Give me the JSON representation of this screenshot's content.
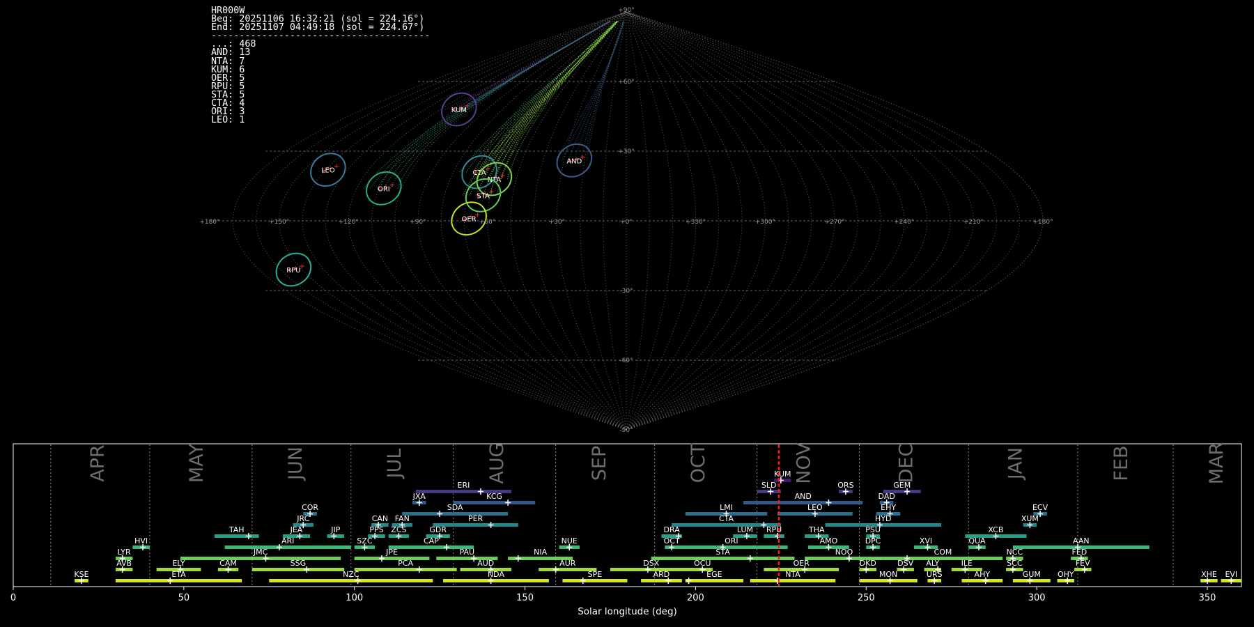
{
  "header": {
    "station": "HR000W",
    "beg": "Beg: 20251106 16:32:21 (sol = 224.16°)",
    "end": "End: 20251107 04:49:18 (sol = 224.67°)",
    "divider": "---------------------------------------",
    "counts": [
      {
        "code": "...",
        "n": 468
      },
      {
        "code": "AND",
        "n": 13
      },
      {
        "code": "NTA",
        "n": 7
      },
      {
        "code": "KUM",
        "n": 6
      },
      {
        "code": "OER",
        "n": 5
      },
      {
        "code": "RPU",
        "n": 5
      },
      {
        "code": "STA",
        "n": 5
      },
      {
        "code": "CTA",
        "n": 4
      },
      {
        "code": "ORI",
        "n": 3
      },
      {
        "code": "LEO",
        "n": 1
      }
    ]
  },
  "chart_data": [
    {
      "type": "scatter",
      "projection": "sinusoidal (radiant sky map, longitude relative to sun)",
      "lon_tick_labels": [
        "+180°",
        "+150°",
        "+120°",
        "+90°",
        "+60°",
        "+30°",
        "+0°",
        "+330°",
        "+300°",
        "+270°",
        "+240°",
        "+210°",
        "+180°"
      ],
      "lat_tick_labels": [
        "+90°",
        "+60°",
        "+30°",
        "-30°",
        "-60°",
        "-90°"
      ],
      "grid": true,
      "showers": [
        {
          "code": "KUM",
          "lon": 108,
          "lat": 48,
          "color": "#5b3f8c"
        },
        {
          "code": "LEO",
          "lon": 139,
          "lat": 22,
          "color": "#3a7a9a"
        },
        {
          "code": "ORI",
          "lon": 108,
          "lat": 14,
          "color": "#2aa88a"
        },
        {
          "code": "CTA",
          "lon": 68,
          "lat": 21,
          "color": "#2f8c9c"
        },
        {
          "code": "AND",
          "lon": 25,
          "lat": 26,
          "color": "#3d5c8c"
        },
        {
          "code": "NTA",
          "lon": 60,
          "lat": 18,
          "color": "#7fd34e"
        },
        {
          "code": "STA",
          "lon": 63,
          "lat": 11,
          "color": "#5ec962"
        },
        {
          "code": "OER",
          "lon": 68,
          "lat": 1,
          "color": "#c8e020"
        },
        {
          "code": "RPU",
          "lon": 154,
          "lat": -21,
          "color": "#29b09a"
        }
      ]
    },
    {
      "type": "bar",
      "xlabel": "Solar longitude (deg)",
      "xlim": [
        0,
        360
      ],
      "x_ticks": [
        0,
        50,
        100,
        150,
        200,
        250,
        300,
        350
      ],
      "months": [
        {
          "name": "APR",
          "lon": 25
        },
        {
          "name": "MAY",
          "lon": 54
        },
        {
          "name": "JUN",
          "lon": 83
        },
        {
          "name": "JUL",
          "lon": 112
        },
        {
          "name": "AUG",
          "lon": 142
        },
        {
          "name": "SEP",
          "lon": 172
        },
        {
          "name": "OCT",
          "lon": 201
        },
        {
          "name": "NOV",
          "lon": 232
        },
        {
          "name": "DEC",
          "lon": 262
        },
        {
          "name": "JAN",
          "lon": 294
        },
        {
          "name": "FEB",
          "lon": 325
        },
        {
          "name": "MAR",
          "lon": 353
        }
      ],
      "month_boundaries": [
        11,
        40,
        70,
        99,
        129,
        159,
        188,
        218,
        248,
        280,
        312,
        340
      ],
      "current_sol": 224.4,
      "showers": [
        {
          "code": "KSE",
          "start": 18,
          "end": 22,
          "peak": 20,
          "row": 0
        },
        {
          "code": "ETA",
          "start": 30,
          "end": 67,
          "peak": 46,
          "row": 0
        },
        {
          "code": "NZC",
          "start": 75,
          "end": 123,
          "peak": 101,
          "row": 0
        },
        {
          "code": "NDA",
          "start": 126,
          "end": 157,
          "peak": 140,
          "row": 0
        },
        {
          "code": "SPE",
          "start": 161,
          "end": 180,
          "peak": 167,
          "row": 0
        },
        {
          "code": "ARD",
          "start": 184,
          "end": 196,
          "peak": 192,
          "row": 0
        },
        {
          "code": "EGE",
          "start": 197,
          "end": 214,
          "peak": 198,
          "row": 0
        },
        {
          "code": "NTA",
          "start": 216,
          "end": 241,
          "peak": 224,
          "row": 0
        },
        {
          "code": "MON",
          "start": 248,
          "end": 265,
          "peak": 257,
          "row": 0
        },
        {
          "code": "URS",
          "start": 268,
          "end": 272,
          "peak": 270,
          "row": 0
        },
        {
          "code": "AHY",
          "start": 278,
          "end": 290,
          "peak": 285,
          "row": 0
        },
        {
          "code": "GUM",
          "start": 293,
          "end": 304,
          "peak": 298,
          "row": 0
        },
        {
          "code": "OHY",
          "start": 306,
          "end": 311,
          "peak": 309,
          "row": 0
        },
        {
          "code": "XHE",
          "start": 348,
          "end": 353,
          "peak": 350,
          "row": 0
        },
        {
          "code": "EVI",
          "start": 354,
          "end": 360,
          "peak": 357,
          "row": 0
        },
        {
          "code": "AVB",
          "start": 30,
          "end": 35,
          "peak": 32,
          "row": 1
        },
        {
          "code": "ELY",
          "start": 42,
          "end": 55,
          "peak": 49,
          "row": 1
        },
        {
          "code": "CAM",
          "start": 60,
          "end": 66,
          "peak": 63,
          "row": 1
        },
        {
          "code": "SSG",
          "start": 70,
          "end": 97,
          "peak": 86,
          "row": 1
        },
        {
          "code": "PCA",
          "start": 100,
          "end": 130,
          "peak": 119,
          "row": 1
        },
        {
          "code": "AUD",
          "start": 131,
          "end": 146,
          "peak": 140,
          "row": 1
        },
        {
          "code": "AUR",
          "start": 154,
          "end": 171,
          "peak": 159,
          "row": 1
        },
        {
          "code": "DSX",
          "start": 175,
          "end": 199,
          "peak": 186,
          "row": 1
        },
        {
          "code": "OCU",
          "start": 199,
          "end": 205,
          "peak": 202,
          "row": 1
        },
        {
          "code": "OER",
          "start": 220,
          "end": 242,
          "peak": 232,
          "row": 1
        },
        {
          "code": "DKD",
          "start": 248,
          "end": 253,
          "peak": 250,
          "row": 1
        },
        {
          "code": "DSV",
          "start": 259,
          "end": 264,
          "peak": 261,
          "row": 1
        },
        {
          "code": "ALY",
          "start": 267,
          "end": 272,
          "peak": 271,
          "row": 1
        },
        {
          "code": "ILE",
          "start": 275,
          "end": 284,
          "peak": 279,
          "row": 1
        },
        {
          "code": "SCC",
          "start": 291,
          "end": 296,
          "peak": 293,
          "row": 1
        },
        {
          "code": "FEV",
          "start": 311,
          "end": 316,
          "peak": 314,
          "row": 1
        },
        {
          "code": "LYR",
          "start": 30,
          "end": 35,
          "peak": 32,
          "row": 2
        },
        {
          "code": "JMC",
          "start": 49,
          "end": 96,
          "peak": 74,
          "row": 2
        },
        {
          "code": "JPE",
          "start": 100,
          "end": 122,
          "peak": 108,
          "row": 2
        },
        {
          "code": "PAU",
          "start": 124,
          "end": 142,
          "peak": 135,
          "row": 2
        },
        {
          "code": "NIA",
          "start": 145,
          "end": 164,
          "peak": 148,
          "row": 2
        },
        {
          "code": "STA",
          "start": 187,
          "end": 229,
          "peak": 216,
          "row": 2
        },
        {
          "code": "NOO",
          "start": 232,
          "end": 255,
          "peak": 245,
          "row": 2
        },
        {
          "code": "COM",
          "start": 255,
          "end": 290,
          "peak": 262,
          "row": 2
        },
        {
          "code": "NCC",
          "start": 291,
          "end": 296,
          "peak": 293,
          "row": 2
        },
        {
          "code": "FED",
          "start": 310,
          "end": 315,
          "peak": 313,
          "row": 2
        },
        {
          "code": "HVI",
          "start": 35,
          "end": 40,
          "peak": 38,
          "row": 3
        },
        {
          "code": "ARI",
          "start": 62,
          "end": 99,
          "peak": 78,
          "row": 3
        },
        {
          "code": "SZC",
          "start": 100,
          "end": 106,
          "peak": 103,
          "row": 3
        },
        {
          "code": "CAP",
          "start": 110,
          "end": 135,
          "peak": 127,
          "row": 3
        },
        {
          "code": "NUE",
          "start": 160,
          "end": 166,
          "peak": 163,
          "row": 3
        },
        {
          "code": "OCT",
          "start": 191,
          "end": 195,
          "peak": 193,
          "row": 3
        },
        {
          "code": "ORI",
          "start": 194,
          "end": 227,
          "peak": 208,
          "row": 3
        },
        {
          "code": "AMO",
          "start": 233,
          "end": 245,
          "peak": 239,
          "row": 3
        },
        {
          "code": "DPC",
          "start": 250,
          "end": 254,
          "peak": 252,
          "row": 3
        },
        {
          "code": "XVI",
          "start": 264,
          "end": 271,
          "peak": 268,
          "row": 3
        },
        {
          "code": "QUA",
          "start": 280,
          "end": 285,
          "peak": 283,
          "row": 3
        },
        {
          "code": "AAN",
          "start": 293,
          "end": 333,
          "peak": 312,
          "row": 3
        },
        {
          "code": "TAH",
          "start": 59,
          "end": 72,
          "peak": 69,
          "row": 4
        },
        {
          "code": "JEA",
          "start": 79,
          "end": 87,
          "peak": 84,
          "row": 4
        },
        {
          "code": "JIP",
          "start": 92,
          "end": 97,
          "peak": 94,
          "row": 4
        },
        {
          "code": "PPS",
          "start": 104,
          "end": 109,
          "peak": 106,
          "row": 4
        },
        {
          "code": "ZCS",
          "start": 110,
          "end": 116,
          "peak": 113,
          "row": 4
        },
        {
          "code": "GDR",
          "start": 121,
          "end": 128,
          "peak": 125,
          "row": 4
        },
        {
          "code": "DRA",
          "start": 190,
          "end": 196,
          "peak": 195,
          "row": 4
        },
        {
          "code": "LUM",
          "start": 211,
          "end": 218,
          "peak": 215,
          "row": 4
        },
        {
          "code": "RPU",
          "start": 220,
          "end": 226,
          "peak": 224,
          "row": 4
        },
        {
          "code": "THA",
          "start": 232,
          "end": 239,
          "peak": 236,
          "row": 4
        },
        {
          "code": "PSU",
          "start": 250,
          "end": 254,
          "peak": 252,
          "row": 4
        },
        {
          "code": "XCB",
          "start": 279,
          "end": 297,
          "peak": 288,
          "row": 4
        },
        {
          "code": "JRC",
          "start": 82,
          "end": 88,
          "peak": 85,
          "row": 5
        },
        {
          "code": "CAN",
          "start": 105,
          "end": 110,
          "peak": 107,
          "row": 5
        },
        {
          "code": "FAN",
          "start": 111,
          "end": 117,
          "peak": 114,
          "row": 5
        },
        {
          "code": "PER",
          "start": 123,
          "end": 148,
          "peak": 140,
          "row": 5
        },
        {
          "code": "CTA",
          "start": 193,
          "end": 225,
          "peak": 220,
          "row": 5
        },
        {
          "code": "HYD",
          "start": 238,
          "end": 272,
          "peak": 254,
          "row": 5
        },
        {
          "code": "XUM",
          "start": 296,
          "end": 300,
          "peak": 298,
          "row": 5
        },
        {
          "code": "COR",
          "start": 85,
          "end": 89,
          "peak": 87,
          "row": 6
        },
        {
          "code": "SDA",
          "start": 114,
          "end": 145,
          "peak": 125,
          "row": 6
        },
        {
          "code": "LMI",
          "start": 197,
          "end": 221,
          "peak": 209,
          "row": 6
        },
        {
          "code": "LEO",
          "start": 224,
          "end": 246,
          "peak": 235,
          "row": 6
        },
        {
          "code": "EHY",
          "start": 253,
          "end": 260,
          "peak": 257,
          "row": 6
        },
        {
          "code": "ECV",
          "start": 299,
          "end": 303,
          "peak": 301,
          "row": 6
        },
        {
          "code": "JXA",
          "start": 117,
          "end": 121,
          "peak": 119,
          "row": 7
        },
        {
          "code": "KCG",
          "start": 129,
          "end": 153,
          "peak": 145,
          "row": 7
        },
        {
          "code": "AND",
          "start": 214,
          "end": 249,
          "peak": 239,
          "row": 7
        },
        {
          "code": "DAD",
          "start": 254,
          "end": 258,
          "peak": 256,
          "row": 7
        },
        {
          "code": "ERI",
          "start": 118,
          "end": 146,
          "peak": 137,
          "row": 8
        },
        {
          "code": "SLD",
          "start": 218,
          "end": 225,
          "peak": 222,
          "row": 8
        },
        {
          "code": "ORS",
          "start": 242,
          "end": 246,
          "peak": 244,
          "row": 8
        },
        {
          "code": "GEM",
          "start": 255,
          "end": 266,
          "peak": 262,
          "row": 8
        },
        {
          "code": "KUM",
          "start": 223,
          "end": 228,
          "peak": 225,
          "row": 9
        }
      ]
    }
  ]
}
